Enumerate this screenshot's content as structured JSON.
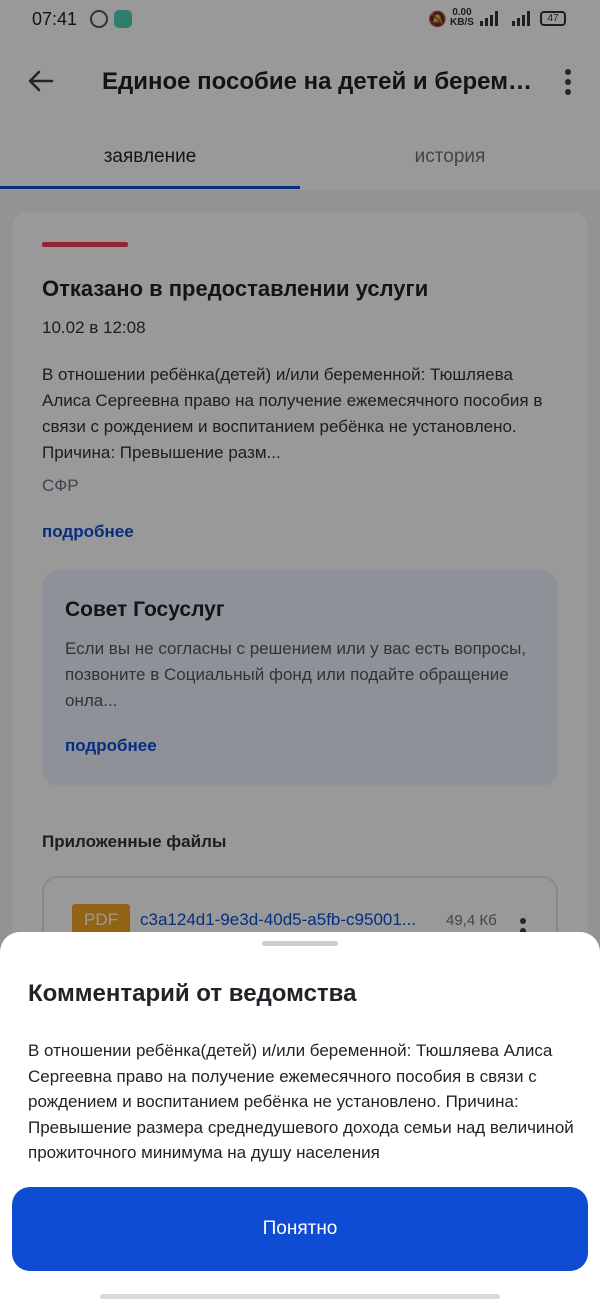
{
  "status_bar": {
    "time": "07:41",
    "net_speed_value": "0.00",
    "net_speed_unit": "KB/S",
    "battery": "47"
  },
  "header": {
    "title": "Единое пособие на детей и беременных"
  },
  "tabs": [
    {
      "label": "заявление",
      "active": true
    },
    {
      "label": "история",
      "active": false
    }
  ],
  "application": {
    "status_title": "Отказано в предоставлении услуги",
    "date": "10.02 в 12:08",
    "text": "В отношении ребёнка(детей) и/или беременной: Тюшляева Алиса Сергеевна право на получение ежемесячного пособия в связи с рождением и воспитанием ребёнка не установлено. Причина: Превышение разм...",
    "organization": "СФР",
    "more_link": "подробнее"
  },
  "advice": {
    "title": "Совет Госуслуг",
    "text": "Если вы не согласны с решением или у вас есть вопросы, позвоните в Социальный фонд или подайте обращение онла...",
    "more_link": "подробнее"
  },
  "files": {
    "title": "Приложенные файлы",
    "items": [
      {
        "type": "PDF",
        "name": "c3a124d1-9e3d-40d5-a5fb-c95001...",
        "size": "49,4 Кб"
      }
    ]
  },
  "sheet": {
    "title": "Комментарий от ведомства",
    "text": "В отношении ребёнка(детей) и/или беременной: Тюшляева Алиса Сергеевна право на получение ежемесячного пособия в связи с рождением и воспитанием ребёнка не установлено. Причина: Превышение размера среднедушевого дохода семьи над величиной прожиточного минимума на душу населения",
    "button": "Понятно"
  },
  "colors": {
    "primary": "#0d4cd3",
    "status_red": "#ee3f58",
    "pdf_orange": "#f5a623"
  }
}
